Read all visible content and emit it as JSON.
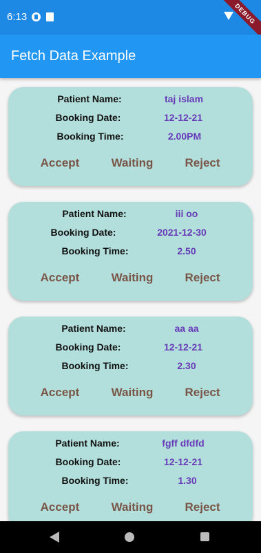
{
  "status_bar": {
    "time": "6:13",
    "debug_label": "DEBUG"
  },
  "app_bar": {
    "title": "Fetch Data Example"
  },
  "labels": {
    "patient_name": "Patient Name:",
    "booking_date": "Booking Date:",
    "booking_time": "Booking Time:"
  },
  "actions": {
    "accept": "Accept",
    "waiting": "Waiting",
    "reject": "Reject"
  },
  "bookings": [
    {
      "patient_name": "taj islam",
      "booking_date": "12-12-21",
      "booking_time": "2.00PM"
    },
    {
      "patient_name": "iii oo",
      "booking_date": "2021-12-30",
      "booking_time": "2.50"
    },
    {
      "patient_name": "aa aa",
      "booking_date": "12-12-21",
      "booking_time": "2.30"
    },
    {
      "patient_name": "fgff dfdfd",
      "booking_date": "12-12-21",
      "booking_time": "1.30"
    }
  ]
}
